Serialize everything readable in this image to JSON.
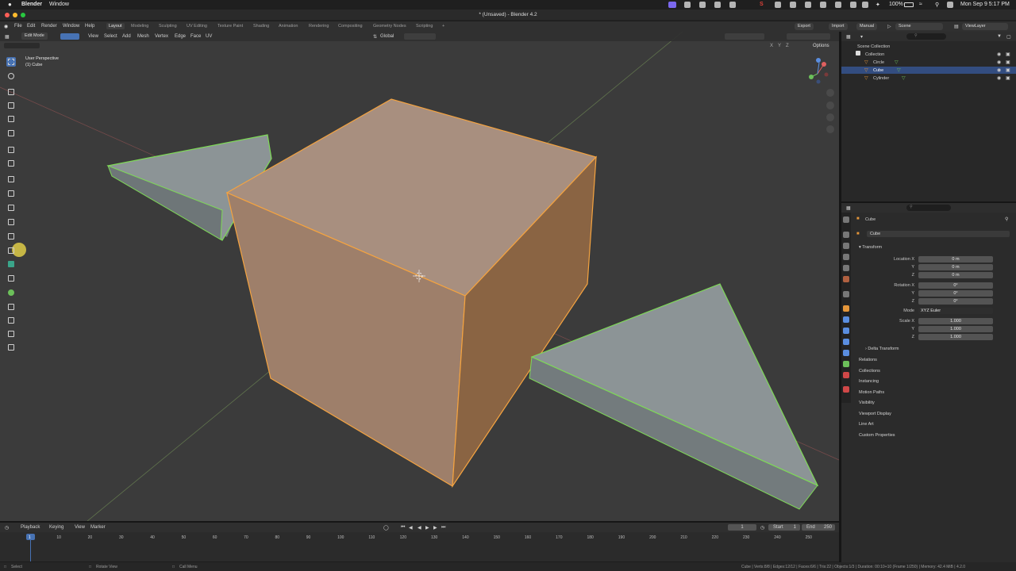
{
  "mac_menubar": {
    "app_name": "Blender",
    "menu": [
      "Window"
    ],
    "battery": "100%",
    "datetime": "Mon Sep 9  5:17 PM"
  },
  "window": {
    "title": "* (Unsaved) - Blender 4.2"
  },
  "topbar": {
    "menus": [
      "File",
      "Edit",
      "Render",
      "Window",
      "Help"
    ],
    "workspaces": [
      "Layout",
      "Modeling",
      "Sculpting",
      "UV Editing",
      "Texture Paint",
      "Shading",
      "Animation",
      "Rendering",
      "Compositing",
      "Geometry Nodes",
      "Scripting"
    ],
    "active_workspace": "Layout",
    "add_workspace": "+",
    "export_label": "Export",
    "import_label": "Import",
    "manual_label": "Manual",
    "scene_label": "Scene",
    "viewlayer_label": "ViewLayer"
  },
  "viewport_header": {
    "mode": "Edit Mode",
    "menus": [
      "View",
      "Select",
      "Add",
      "Mesh",
      "Vertex",
      "Edge",
      "Face",
      "UV"
    ],
    "transform_orientation": "Global",
    "options_label": "Options",
    "axis_labels": [
      "X",
      "Y",
      "Z"
    ]
  },
  "viewport": {
    "perspective_label": "User Perspective",
    "object_label": "(1) Cube",
    "colors": {
      "background": "#3b3b3b",
      "cube_top": "#a88f7f",
      "cube_left": "#9e7f6a",
      "cube_right": "#8a6443",
      "selected_edge": "#f4a340",
      "other_edge": "#7ed957",
      "wedge_face": "#8c9496",
      "wedge_side": "#737b7d"
    }
  },
  "toolbar": {
    "tools": [
      "select-box",
      "cursor",
      "move",
      "rotate",
      "scale",
      "transform",
      "annotate",
      "measure",
      "add-cube",
      "extrude",
      "inset",
      "bevel",
      "loop-cut",
      "knife",
      "poly-build",
      "spin",
      "smooth",
      "edge-slide",
      "shrink-fatten",
      "shear",
      "rip-region"
    ]
  },
  "outliner": {
    "search_placeholder": "",
    "scene_collection": "Scene Collection",
    "collection": "Collection",
    "objects": [
      "Circle",
      "Cube",
      "Cylinder"
    ],
    "selected_object": "Cube"
  },
  "properties": {
    "breadcrumb": "Cube",
    "object_name": "Cube",
    "transform_title": "Transform",
    "location_label": "Location X",
    "location": [
      "0 m",
      "0 m",
      "0 m"
    ],
    "rotation_label": "Rotation X",
    "rotation": [
      "0°",
      "0°",
      "0°"
    ],
    "mode_label": "Mode",
    "mode_value": "XYZ Euler",
    "scale_label": "Scale X",
    "scale": [
      "1.000",
      "1.000",
      "1.000"
    ],
    "axis_y": "Y",
    "axis_z": "Z",
    "delta_transform": "Delta Transform",
    "sections": [
      "Relations",
      "Collections",
      "Instancing",
      "Motion Paths",
      "Visibility",
      "Viewport Display",
      "Line Art",
      "Custom Properties"
    ]
  },
  "timeline": {
    "menus": [
      "Playback",
      "Keying",
      "View",
      "Marker"
    ],
    "current_frame": "1",
    "start_label": "Start",
    "start_value": "1",
    "end_label": "End",
    "end_value": "250",
    "ticks": [
      "1",
      "10",
      "20",
      "30",
      "40",
      "50",
      "60",
      "70",
      "80",
      "90",
      "100",
      "110",
      "120",
      "130",
      "140",
      "150",
      "160",
      "170",
      "180",
      "190",
      "200",
      "210",
      "220",
      "230",
      "240",
      "250"
    ]
  },
  "statusbar": {
    "select": "Select",
    "rotate": "Rotate View",
    "menu": "Call Menu",
    "stats": "Cube | Verts:8/8 | Edges:12/12 | Faces:6/6 | Tris:22 | Objects:1/3 | Duration: 00:10+10 (Frame 1/250) | Memory: 42.4 MiB | 4.2.0"
  }
}
